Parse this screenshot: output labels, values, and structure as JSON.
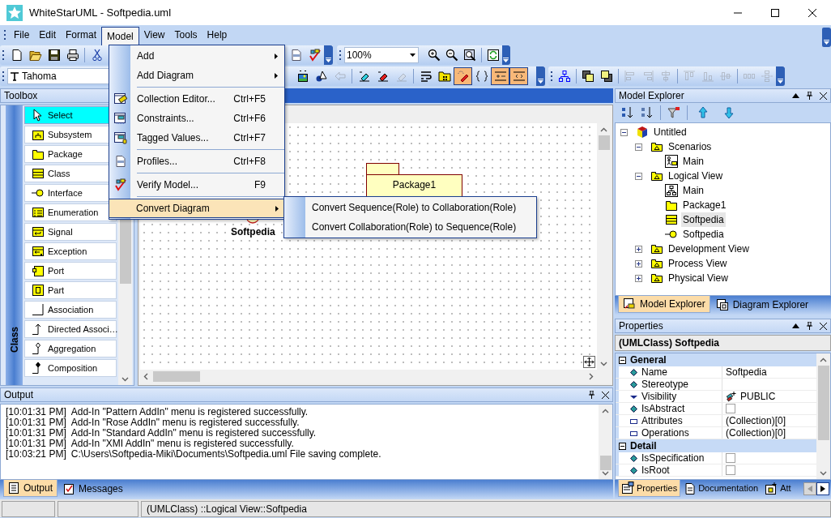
{
  "window": {
    "title": "WhiteStarUML - Softpedia.uml"
  },
  "menubar": [
    {
      "label": "File",
      "selected": false
    },
    {
      "label": "Edit",
      "selected": false
    },
    {
      "label": "Format",
      "selected": false
    },
    {
      "label": "Model",
      "selected": true
    },
    {
      "label": "View",
      "selected": false
    },
    {
      "label": "Tools",
      "selected": false
    },
    {
      "label": "Help",
      "selected": false
    }
  ],
  "toolbar_standard": {
    "groups_left": [
      [
        {
          "kind": "new"
        },
        {
          "kind": "open"
        },
        {
          "kind": "save"
        },
        {
          "kind": "print"
        }
      ],
      [
        {
          "kind": "cut"
        }
      ]
    ],
    "groups_right": [
      [
        {
          "kind": "profiles"
        },
        {
          "kind": "verify"
        }
      ]
    ]
  },
  "toolbar_zoom": {
    "zoom": "100%",
    "groups": [
      [
        {
          "kind": "zoomin"
        },
        {
          "kind": "zoomout"
        },
        {
          "kind": "zoomfit"
        }
      ],
      [
        {
          "kind": "refresh"
        }
      ]
    ]
  },
  "toolbar_format": {
    "font": "Tahoma",
    "groups": [
      [
        {
          "kind": "fill",
          "pressed": false,
          "disabled": false
        },
        {
          "kind": "shape",
          "pressed": false,
          "disabled": false
        },
        {
          "kind": "arrow",
          "pressed": false,
          "disabled": true
        }
      ],
      [
        {
          "kind": "erasecyan",
          "pressed": false,
          "disabled": false
        },
        {
          "kind": "erasered",
          "pressed": false,
          "disabled": false
        },
        {
          "kind": "erasegray",
          "pressed": false,
          "disabled": true
        }
      ],
      [
        {
          "kind": "wrap",
          "pressed": false,
          "disabled": false
        },
        {
          "kind": "folder",
          "pressed": false,
          "disabled": false
        },
        {
          "kind": "edit",
          "pressed": true,
          "disabled": false
        },
        {
          "kind": "braces",
          "pressed": false,
          "disabled": false
        },
        {
          "kind": "line1",
          "pressed": true,
          "disabled": false
        },
        {
          "kind": "line2",
          "pressed": true,
          "disabled": false
        }
      ]
    ]
  },
  "toolbar_layout": {
    "groups": [
      [
        {
          "kind": "layout",
          "pressed": false,
          "disabled": false
        }
      ],
      [
        {
          "kind": "front",
          "pressed": false,
          "disabled": false
        },
        {
          "kind": "back",
          "pressed": false,
          "disabled": false
        }
      ],
      [
        {
          "kind": "alignleft",
          "pressed": false,
          "disabled": true
        },
        {
          "kind": "alignright",
          "pressed": false,
          "disabled": true
        },
        {
          "kind": "aligncenter",
          "pressed": false,
          "disabled": true
        }
      ],
      [
        {
          "kind": "aligntop",
          "pressed": false,
          "disabled": true
        },
        {
          "kind": "alignbottom",
          "pressed": false,
          "disabled": true
        },
        {
          "kind": "alignmiddle",
          "pressed": false,
          "disabled": true
        }
      ],
      [
        {
          "kind": "spaceh",
          "pressed": false,
          "disabled": true
        },
        {
          "kind": "spacev",
          "pressed": false,
          "disabled": true
        }
      ]
    ]
  },
  "toolbox": {
    "title": "Toolbox",
    "tab": "Class",
    "items": [
      {
        "label": "Select",
        "kind": "pointer",
        "selected": true
      },
      {
        "label": "Subsystem",
        "kind": "subsystem",
        "selected": false
      },
      {
        "label": "Package",
        "kind": "package",
        "selected": false
      },
      {
        "label": "Class",
        "kind": "class",
        "selected": false
      },
      {
        "label": "Interface",
        "kind": "interface",
        "selected": false
      },
      {
        "label": "Enumeration",
        "kind": "enumeration",
        "selected": false
      },
      {
        "label": "Signal",
        "kind": "signal",
        "selected": false
      },
      {
        "label": "Exception",
        "kind": "exception",
        "selected": false
      },
      {
        "label": "Port",
        "kind": "port",
        "selected": false
      },
      {
        "label": "Part",
        "kind": "part",
        "selected": false
      },
      {
        "label": "Association",
        "kind": "association",
        "selected": false
      },
      {
        "label": "Directed Associ…",
        "kind": "directed",
        "selected": false
      },
      {
        "label": "Aggregation",
        "kind": "aggregation",
        "selected": false
      },
      {
        "label": "Composition",
        "kind": "composition",
        "selected": false
      }
    ]
  },
  "diagram": {
    "elements": [
      {
        "kind": "package",
        "label": "Package1"
      },
      {
        "kind": "interface",
        "label": "Softpedia"
      }
    ]
  },
  "model_menu": {
    "items": [
      {
        "label": "Add",
        "submenu": true,
        "selected": false
      },
      {
        "label": "Add Diagram",
        "submenu": true,
        "selected": false
      },
      {
        "label": "Collection Editor...",
        "shortcut": "Ctrl+F5",
        "separator_before": true,
        "selected": false
      },
      {
        "label": "Constraints...",
        "shortcut": "Ctrl+F6",
        "selected": false
      },
      {
        "label": "Tagged Values...",
        "shortcut": "Ctrl+F7",
        "selected": false
      },
      {
        "label": "Profiles...",
        "shortcut": "Ctrl+F8",
        "separator_before": true,
        "selected": false
      },
      {
        "label": "Verify Model...",
        "shortcut": "F9",
        "separator_before": true,
        "selected": false
      },
      {
        "label": "Convert Diagram",
        "submenu": true,
        "separator_before": true,
        "selected": true
      }
    ]
  },
  "convert_submenu": {
    "items": [
      {
        "label": "Convert Sequence(Role) to Collaboration(Role)"
      },
      {
        "label": "Convert Collaboration(Role) to Sequence(Role)"
      }
    ]
  },
  "output": {
    "title": "Output",
    "lines": [
      {
        "time": "[10:01:31 PM]",
        "message": "Add-In \"Pattern AddIn\" menu is registered successfully."
      },
      {
        "time": "[10:01:31 PM]",
        "message": "Add-In \"Rose AddIn\" menu is registered successfully."
      },
      {
        "time": "[10:01:31 PM]",
        "message": "Add-In \"Standard AddIn\" menu is registered successfully."
      },
      {
        "time": "[10:01:31 PM]",
        "message": "Add-In \"XMI AddIn\" menu is registered successfully."
      },
      {
        "time": "[10:03:21 PM]",
        "message": "C:\\Users\\Softpedia-Miki\\Documents\\Softpedia.uml File saving complete."
      }
    ],
    "tabs": [
      {
        "label": "Output",
        "selected": true
      },
      {
        "label": "Messages",
        "selected": false
      }
    ]
  },
  "model_explorer": {
    "title": "Model Explorer",
    "tree": [
      {
        "label": "Untitled",
        "kind": "model",
        "expanded": true,
        "selected": false,
        "children": [
          {
            "label": "Scenarios",
            "kind": "view",
            "expanded": true,
            "selected": false,
            "children": [
              {
                "label": "Main",
                "kind": "usecase",
                "selected": false
              }
            ]
          },
          {
            "label": "Logical View",
            "kind": "view",
            "expanded": true,
            "selected": false,
            "children": [
              {
                "label": "Main",
                "kind": "classdiagram",
                "selected": false
              },
              {
                "label": "Package1",
                "kind": "package",
                "selected": false
              },
              {
                "label": "Softpedia",
                "kind": "class",
                "selected": true
              },
              {
                "label": "Softpedia",
                "kind": "interface",
                "selected": false
              }
            ]
          },
          {
            "label": "Development View",
            "kind": "view",
            "expanded": false,
            "selected": false
          },
          {
            "label": "Process View",
            "kind": "view",
            "expanded": false,
            "selected": false
          },
          {
            "label": "Physical View",
            "kind": "view",
            "expanded": false,
            "selected": false
          }
        ]
      }
    ],
    "tabs": [
      {
        "label": "Model Explorer",
        "selected": true
      },
      {
        "label": "Diagram Explorer",
        "selected": false
      }
    ]
  },
  "properties": {
    "title": "Properties",
    "subject": "(UMLClass) Softpedia",
    "sections": [
      {
        "title": "General",
        "expanded": true,
        "rows": [
          {
            "name": "Name",
            "kind": "text",
            "value": "Softpedia"
          },
          {
            "name": "Stereotype",
            "kind": "text"
          },
          {
            "name": "Visibility",
            "kind": "enum",
            "value": "PUBLIC"
          },
          {
            "name": "IsAbstract",
            "kind": "checkbox",
            "checked": false
          },
          {
            "name": "Attributes",
            "kind": "collection",
            "value": "(Collection)[0]"
          },
          {
            "name": "Operations",
            "kind": "collection",
            "value": "(Collection)[0]"
          }
        ]
      },
      {
        "title": "Detail",
        "expanded": true,
        "rows": [
          {
            "name": "IsSpecification",
            "kind": "checkbox",
            "checked": false
          },
          {
            "name": "IsRoot",
            "kind": "checkbox",
            "checked": false
          }
        ]
      }
    ],
    "tabs": [
      {
        "label": "Properties",
        "selected": true
      },
      {
        "label": "Documentation",
        "selected": false
      },
      {
        "label": "Att",
        "selected": false
      }
    ]
  },
  "status_bar": {
    "text": "(UMLClass) ::Logical View::Softpedia"
  }
}
